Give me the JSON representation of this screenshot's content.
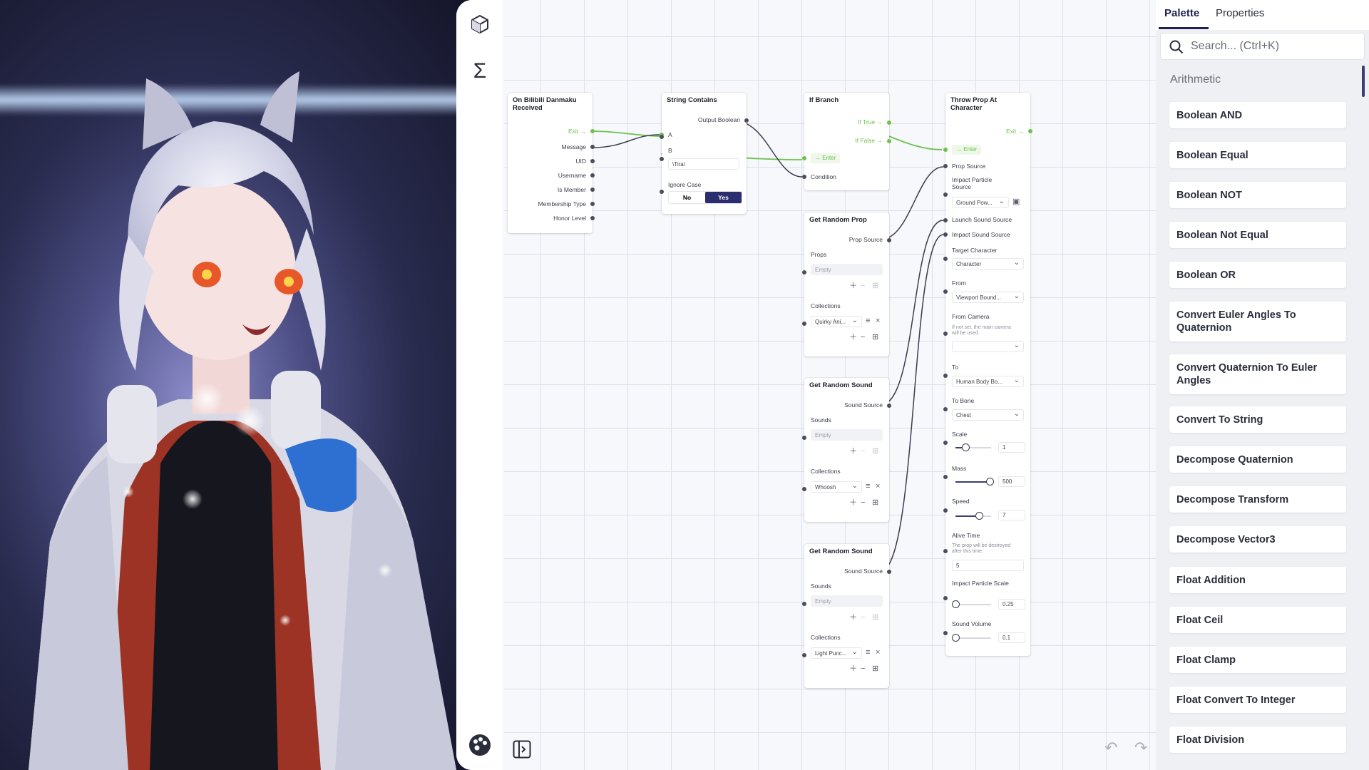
{
  "canvas": {
    "nodes": {
      "danmaku": {
        "title": "On Bilibili Danmaku Received",
        "exit": "Exit",
        "outputs": [
          "Message",
          "UID",
          "Username",
          "Is Member",
          "Membership Type",
          "Honor Level"
        ]
      },
      "contains": {
        "title": "String Contains",
        "output": "Output Boolean",
        "a": "A",
        "b": "B",
        "b_value": "\\Tira/",
        "ignore_case": "Ignore Case",
        "no": "No",
        "yes": "Yes",
        "selected": "Yes"
      },
      "ifbranch": {
        "title": "If Branch",
        "if_true": "If True",
        "if_false": "If False",
        "enter": "Enter",
        "condition": "Condition"
      },
      "randprop": {
        "title": "Get Random Prop",
        "output": "Prop Source",
        "props": "Props",
        "props_value": "Empty",
        "collections": "Collections",
        "collection_value": "Quirky Ani..."
      },
      "randsound1": {
        "title": "Get Random Sound",
        "output": "Sound Source",
        "sounds": "Sounds",
        "sounds_value": "Empty",
        "collections": "Collections",
        "collection_value": "Whoosh"
      },
      "randsound2": {
        "title": "Get Random Sound",
        "output": "Sound Source",
        "sounds": "Sounds",
        "sounds_value": "Empty",
        "collections": "Collections",
        "collection_value": "Light Punc..."
      },
      "throwprop": {
        "title": "Throw Prop At Character",
        "exit": "Exit",
        "enter": "Enter",
        "prop_source": "Prop Source",
        "impact_particle_source": "Impact Particle Source",
        "impact_particle_value": "Ground Pow...",
        "launch_sound": "Launch Sound Source",
        "impact_sound": "Impact Sound Source",
        "target_character": "Target Character",
        "target_value": "Character",
        "from": "From",
        "from_value": "Viewport Bound...",
        "from_camera": "From Camera",
        "from_camera_hint": "If not set, the main camera will be used.",
        "from_camera_value": "",
        "to": "To",
        "to_value": "Human Body Bo...",
        "to_bone": "To Bone",
        "to_bone_value": "Chest",
        "scale": "Scale",
        "scale_value": "1",
        "scale_fraction": 0.28,
        "mass": "Mass",
        "mass_value": "500",
        "mass_fraction": 0.95,
        "speed": "Speed",
        "speed_value": "7",
        "speed_fraction": 0.65,
        "alive_time": "Alive Time",
        "alive_hint": "The prop will be destroyed after this time.",
        "alive_value": "5",
        "impact_particle_scale": "Impact Particle Scale",
        "ips_value": "0.25",
        "ips_fraction": 0.0,
        "sound_volume": "Sound Volume",
        "volume_value": "0.1",
        "volume_fraction": 0.0
      }
    }
  },
  "toolbar": {
    "icons": [
      "cube-icon",
      "sigma-icon",
      "palette-icon",
      "panel-toggle-icon"
    ],
    "undo": "undo-icon",
    "redo": "redo-icon"
  },
  "palette": {
    "tabs": [
      "Palette",
      "Properties"
    ],
    "active_tab": "Palette",
    "search_placeholder": "Search... (Ctrl+K)",
    "category": "Arithmetic",
    "items": [
      "Boolean AND",
      "Boolean Equal",
      "Boolean NOT",
      "Boolean Not Equal",
      "Boolean OR",
      "Convert Euler Angles To Quaternion",
      "Convert Quaternion To Euler Angles",
      "Convert To String",
      "Decompose Quaternion",
      "Decompose Transform",
      "Decompose Vector3",
      "Float Addition",
      "Float Ceil",
      "Float Clamp",
      "Float Convert To Integer",
      "Float Division"
    ]
  },
  "colors": {
    "accent": "#1f2250",
    "flow": "#6cc24a",
    "wire": "#3a3d4c",
    "grid": "#dde0ea"
  }
}
